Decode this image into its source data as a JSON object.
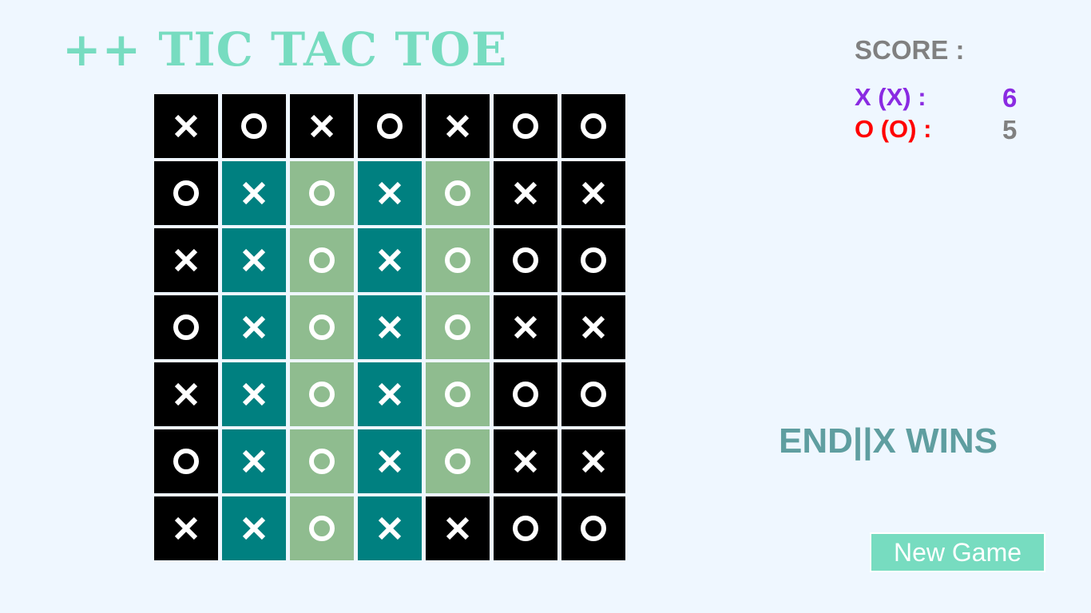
{
  "app": {
    "title": "++ TIC TAC TOE"
  },
  "score": {
    "label": "SCORE :",
    "players": [
      {
        "label": "X (X) :",
        "value": "6",
        "label_color": "#8a2be2",
        "value_color": "#8a2be2"
      },
      {
        "label": "O (O) :",
        "value": "5",
        "label_color": "#ff0000",
        "value_color": "#808080"
      }
    ]
  },
  "status": {
    "text": "END||X WINS"
  },
  "new_game": {
    "label": "New Game"
  },
  "colors": {
    "background": "#eff7ff",
    "title": "#77dcc0",
    "status": "#5f9ea0",
    "cell_black": "#000000",
    "cell_teal": "#008080",
    "cell_sage": "#8fbc8f",
    "button": "#77dcc0"
  },
  "board": {
    "size": 7,
    "rows": [
      [
        {
          "mark": "X",
          "color": "black"
        },
        {
          "mark": "O",
          "color": "black"
        },
        {
          "mark": "X",
          "color": "black"
        },
        {
          "mark": "O",
          "color": "black"
        },
        {
          "mark": "X",
          "color": "black"
        },
        {
          "mark": "O",
          "color": "black"
        },
        {
          "mark": "O",
          "color": "black"
        }
      ],
      [
        {
          "mark": "O",
          "color": "black"
        },
        {
          "mark": "X",
          "color": "teal"
        },
        {
          "mark": "O",
          "color": "sage"
        },
        {
          "mark": "X",
          "color": "teal"
        },
        {
          "mark": "O",
          "color": "sage"
        },
        {
          "mark": "X",
          "color": "black"
        },
        {
          "mark": "X",
          "color": "black"
        }
      ],
      [
        {
          "mark": "X",
          "color": "black"
        },
        {
          "mark": "X",
          "color": "teal"
        },
        {
          "mark": "O",
          "color": "sage"
        },
        {
          "mark": "X",
          "color": "teal"
        },
        {
          "mark": "O",
          "color": "sage"
        },
        {
          "mark": "O",
          "color": "black"
        },
        {
          "mark": "O",
          "color": "black"
        }
      ],
      [
        {
          "mark": "O",
          "color": "black"
        },
        {
          "mark": "X",
          "color": "teal"
        },
        {
          "mark": "O",
          "color": "sage"
        },
        {
          "mark": "X",
          "color": "teal"
        },
        {
          "mark": "O",
          "color": "sage"
        },
        {
          "mark": "X",
          "color": "black"
        },
        {
          "mark": "X",
          "color": "black"
        }
      ],
      [
        {
          "mark": "X",
          "color": "black"
        },
        {
          "mark": "X",
          "color": "teal"
        },
        {
          "mark": "O",
          "color": "sage"
        },
        {
          "mark": "X",
          "color": "teal"
        },
        {
          "mark": "O",
          "color": "sage"
        },
        {
          "mark": "O",
          "color": "black"
        },
        {
          "mark": "O",
          "color": "black"
        }
      ],
      [
        {
          "mark": "O",
          "color": "black"
        },
        {
          "mark": "X",
          "color": "teal"
        },
        {
          "mark": "O",
          "color": "sage"
        },
        {
          "mark": "X",
          "color": "teal"
        },
        {
          "mark": "O",
          "color": "sage"
        },
        {
          "mark": "X",
          "color": "black"
        },
        {
          "mark": "X",
          "color": "black"
        }
      ],
      [
        {
          "mark": "X",
          "color": "black"
        },
        {
          "mark": "X",
          "color": "teal"
        },
        {
          "mark": "O",
          "color": "sage"
        },
        {
          "mark": "X",
          "color": "teal"
        },
        {
          "mark": "X",
          "color": "black"
        },
        {
          "mark": "O",
          "color": "black"
        },
        {
          "mark": "O",
          "color": "black"
        }
      ]
    ]
  }
}
